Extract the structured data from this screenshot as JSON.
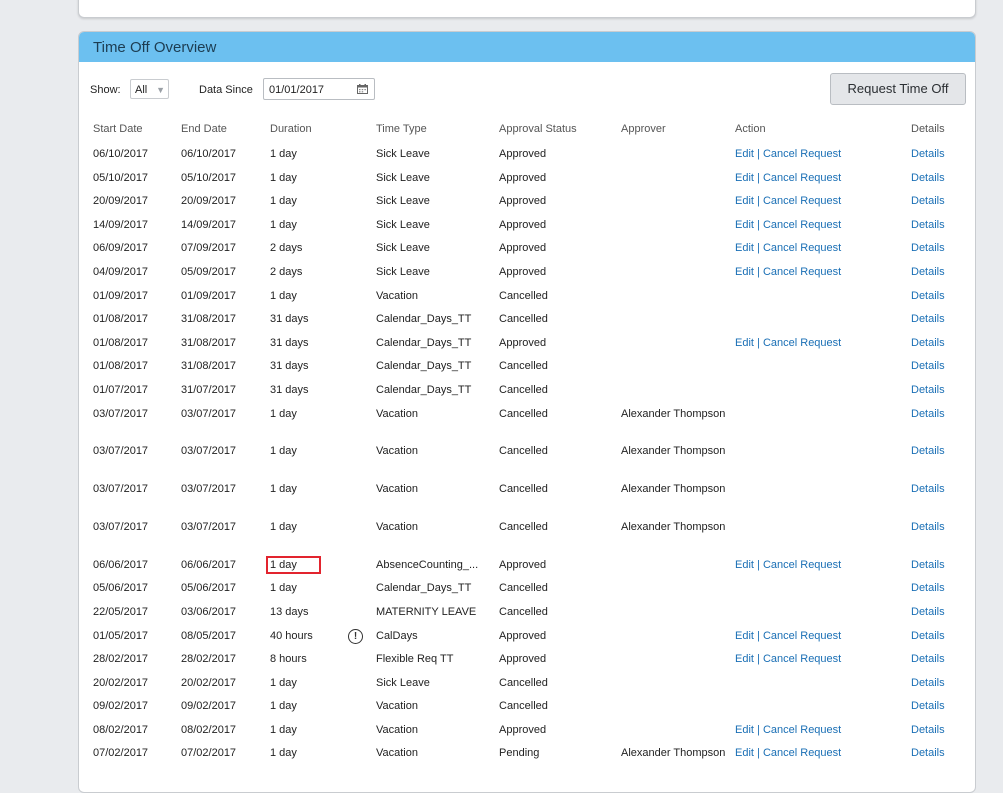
{
  "panel": {
    "title": "Time Off Overview"
  },
  "filters": {
    "show_label": "Show:",
    "show_value": "All",
    "since_label": "Data Since",
    "since_value": "01/01/2017"
  },
  "request_button": "Request Time Off",
  "columns": [
    "Start Date",
    "End Date",
    "Duration",
    "Time Type",
    "Approval Status",
    "Approver",
    "Action",
    "Details"
  ],
  "action_text": {
    "edit": "Edit",
    "sep": " | ",
    "cancel": "Cancel Request"
  },
  "rows": [
    {
      "start": "06/10/2017",
      "end": "06/10/2017",
      "duration": "1 day",
      "type": "Sick Leave",
      "status": "Approved",
      "approver": "",
      "actions": true,
      "details": "Details"
    },
    {
      "start": "05/10/2017",
      "end": "05/10/2017",
      "duration": "1 day",
      "type": "Sick Leave",
      "status": "Approved",
      "approver": "",
      "actions": true,
      "details": "Details"
    },
    {
      "start": "20/09/2017",
      "end": "20/09/2017",
      "duration": "1 day",
      "type": "Sick Leave",
      "status": "Approved",
      "approver": "",
      "actions": true,
      "details": "Details"
    },
    {
      "start": "14/09/2017",
      "end": "14/09/2017",
      "duration": "1 day",
      "type": "Sick Leave",
      "status": "Approved",
      "approver": "",
      "actions": true,
      "details": "Details"
    },
    {
      "start": "06/09/2017",
      "end": "07/09/2017",
      "duration": "2 days",
      "type": "Sick Leave",
      "status": "Approved",
      "approver": "",
      "actions": true,
      "details": "Details"
    },
    {
      "start": "04/09/2017",
      "end": "05/09/2017",
      "duration": "2 days",
      "type": "Sick Leave",
      "status": "Approved",
      "approver": "",
      "actions": true,
      "details": "Details"
    },
    {
      "start": "01/09/2017",
      "end": "01/09/2017",
      "duration": "1 day",
      "type": "Vacation",
      "status": "Cancelled",
      "approver": "",
      "actions": false,
      "details": "Details"
    },
    {
      "start": "01/08/2017",
      "end": "31/08/2017",
      "duration": "31 days",
      "type": "Calendar_Days_TT",
      "status": "Cancelled",
      "approver": "",
      "actions": false,
      "details": "Details"
    },
    {
      "start": "01/08/2017",
      "end": "31/08/2017",
      "duration": "31 days",
      "type": "Calendar_Days_TT",
      "status": "Approved",
      "approver": "",
      "actions": true,
      "details": "Details"
    },
    {
      "start": "01/08/2017",
      "end": "31/08/2017",
      "duration": "31 days",
      "type": "Calendar_Days_TT",
      "status": "Cancelled",
      "approver": "",
      "actions": false,
      "details": "Details"
    },
    {
      "start": "01/07/2017",
      "end": "31/07/2017",
      "duration": "31 days",
      "type": "Calendar_Days_TT",
      "status": "Cancelled",
      "approver": "",
      "actions": false,
      "details": "Details"
    },
    {
      "start": "03/07/2017",
      "end": "03/07/2017",
      "duration": "1 day",
      "type": "Vacation",
      "status": "Cancelled",
      "approver": "Alexander Thompson",
      "actions": false,
      "details": "Details"
    },
    {
      "start": "03/07/2017",
      "end": "03/07/2017",
      "duration": "1 day",
      "type": "Vacation",
      "status": "Cancelled",
      "approver": "Alexander Thompson",
      "actions": false,
      "details": "Details"
    },
    {
      "start": "03/07/2017",
      "end": "03/07/2017",
      "duration": "1 day",
      "type": "Vacation",
      "status": "Cancelled",
      "approver": "Alexander Thompson",
      "actions": false,
      "details": "Details"
    },
    {
      "start": "03/07/2017",
      "end": "03/07/2017",
      "duration": "1 day",
      "type": "Vacation",
      "status": "Cancelled",
      "approver": "Alexander Thompson",
      "actions": false,
      "details": "Details"
    },
    {
      "start": "06/06/2017",
      "end": "06/06/2017",
      "duration": "1 day",
      "type": "AbsenceCounting_...",
      "status": "Approved",
      "approver": "",
      "actions": true,
      "details": "Details",
      "highlight": true
    },
    {
      "start": "05/06/2017",
      "end": "05/06/2017",
      "duration": "1 day",
      "type": "Calendar_Days_TT",
      "status": "Cancelled",
      "approver": "",
      "actions": false,
      "details": "Details"
    },
    {
      "start": "22/05/2017",
      "end": "03/06/2017",
      "duration": "13 days",
      "type": "MATERNITY LEAVE",
      "status": "Cancelled",
      "approver": "",
      "actions": false,
      "details": "Details"
    },
    {
      "start": "01/05/2017",
      "end": "08/05/2017",
      "duration": "40 hours",
      "type": "CalDays",
      "status": "Approved",
      "approver": "",
      "actions": true,
      "details": "Details",
      "warning": true
    },
    {
      "start": "28/02/2017",
      "end": "28/02/2017",
      "duration": "8 hours",
      "type": "Flexible Req TT",
      "status": "Approved",
      "approver": "",
      "actions": true,
      "details": "Details"
    },
    {
      "start": "20/02/2017",
      "end": "20/02/2017",
      "duration": "1 day",
      "type": "Sick Leave",
      "status": "Cancelled",
      "approver": "",
      "actions": false,
      "details": "Details"
    },
    {
      "start": "09/02/2017",
      "end": "09/02/2017",
      "duration": "1 day",
      "type": "Vacation",
      "status": "Cancelled",
      "approver": "",
      "actions": false,
      "details": "Details"
    },
    {
      "start": "08/02/2017",
      "end": "08/02/2017",
      "duration": "1 day",
      "type": "Vacation",
      "status": "Approved",
      "approver": "",
      "actions": true,
      "details": "Details"
    },
    {
      "start": "07/02/2017",
      "end": "07/02/2017",
      "duration": "1 day",
      "type": "Vacation",
      "status": "Pending",
      "approver": "Alexander Thompson",
      "actions": true,
      "details": "Details"
    }
  ]
}
